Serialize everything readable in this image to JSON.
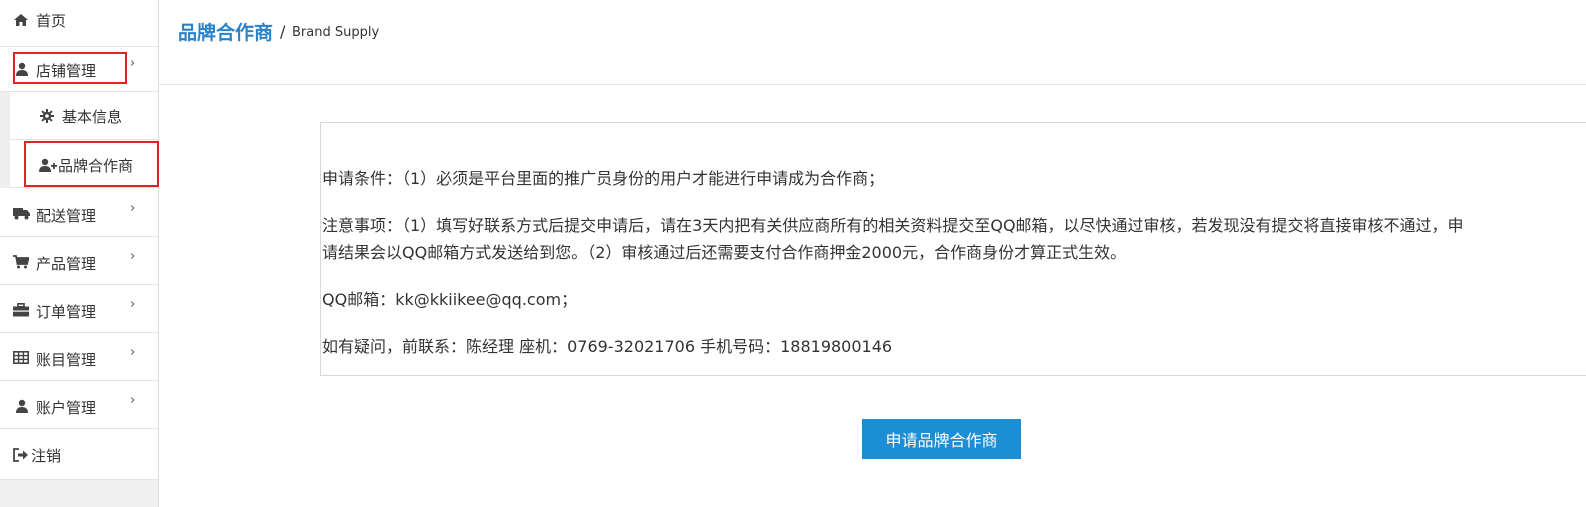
{
  "colors": {
    "accent": "#2a83c9",
    "button_bg": "#1b8ed6",
    "highlight_border": "#e02424"
  },
  "sidebar": {
    "items": [
      {
        "label": "首页",
        "icon": "home-icon"
      },
      {
        "label": "店铺管理",
        "icon": "user-icon",
        "has_chevron": true,
        "highlighted": true
      },
      {
        "label": "配送管理",
        "icon": "truck-icon",
        "has_chevron": true
      },
      {
        "label": "产品管理",
        "icon": "cart-icon",
        "has_chevron": true
      },
      {
        "label": "订单管理",
        "icon": "briefcase-icon",
        "has_chevron": true
      },
      {
        "label": "账目管理",
        "icon": "table-icon",
        "has_chevron": true
      },
      {
        "label": "账户管理",
        "icon": "user-icon",
        "has_chevron": true
      },
      {
        "label": "注销",
        "icon": "sign-out-icon"
      }
    ],
    "sub_items": [
      {
        "label": "基本信息",
        "icon": "gear-icon"
      },
      {
        "label": "品牌合作商",
        "icon": "user-plus-icon",
        "highlighted": true
      }
    ],
    "chevron": "›"
  },
  "header": {
    "title": "品牌合作商",
    "separator": "/",
    "subtitle": "Brand Supply"
  },
  "info": {
    "line1": "申请条件：（1）必须是平台里面的推广员身份的用户才能进行申请成为合作商；",
    "line2": "注意事项：（1）填写好联系方式后提交申请后，请在3天内把有关供应商所有的相关资料提交至QQ邮箱，以尽快通过审核，若发现没有提交将直接审核不通过，申",
    "line3": "请结果会以QQ邮箱方式发送给到您。（2）审核通过后还需要支付合作商押金2000元，合作商身份才算正式生效。",
    "line4": "QQ邮箱：kk@kkiikee@qq.com；",
    "line5": "如有疑问，前联系：陈经理  座机：0769-32021706  手机号码：18819800146"
  },
  "apply_button": {
    "label": "申请品牌合作商"
  }
}
